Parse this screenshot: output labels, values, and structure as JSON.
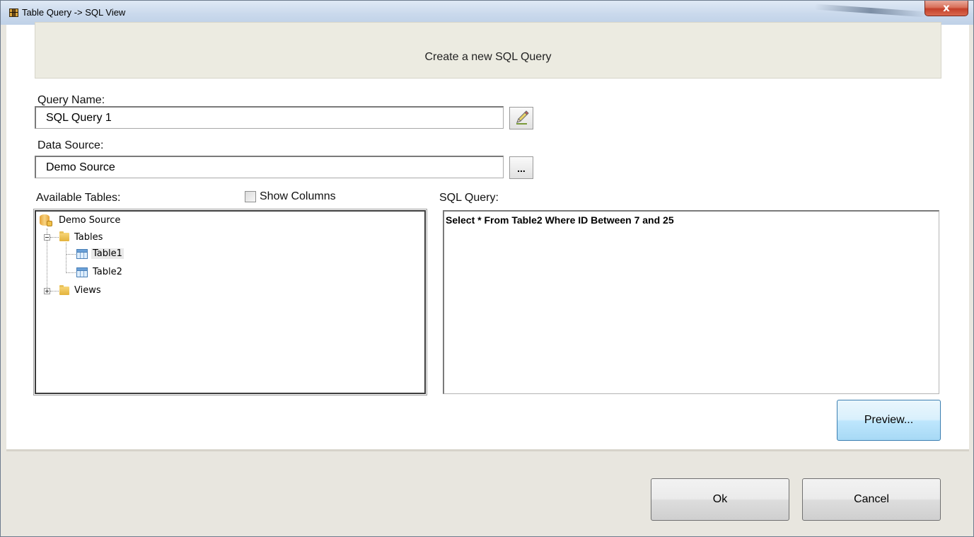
{
  "window": {
    "title": "Table Query -> SQL View",
    "close_label": "x"
  },
  "header": {
    "title": "Create a new SQL Query"
  },
  "form": {
    "query_name_label": "Query Name:",
    "query_name_value": "SQL Query 1",
    "data_source_label": "Data Source:",
    "data_source_value": "Demo Source",
    "browse_label": "...",
    "available_tables_label": "Available Tables:",
    "show_columns_label": "Show Columns",
    "show_columns_checked": false,
    "sql_query_label": "SQL Query:"
  },
  "tree": {
    "root": "Demo Source",
    "tables_folder": "Tables",
    "tables": [
      "Table1",
      "Table2"
    ],
    "views_folder": "Views",
    "selected": "Table1"
  },
  "sql": {
    "text": "Select * From Table2 Where ID Between 7 and 25"
  },
  "buttons": {
    "preview": "Preview...",
    "ok": "Ok",
    "cancel": "Cancel"
  },
  "icons": {
    "title": "table-app-icon",
    "edit": "pencil-icon",
    "root": "database-icon",
    "folder": "folder-icon",
    "table": "table-icon"
  }
}
